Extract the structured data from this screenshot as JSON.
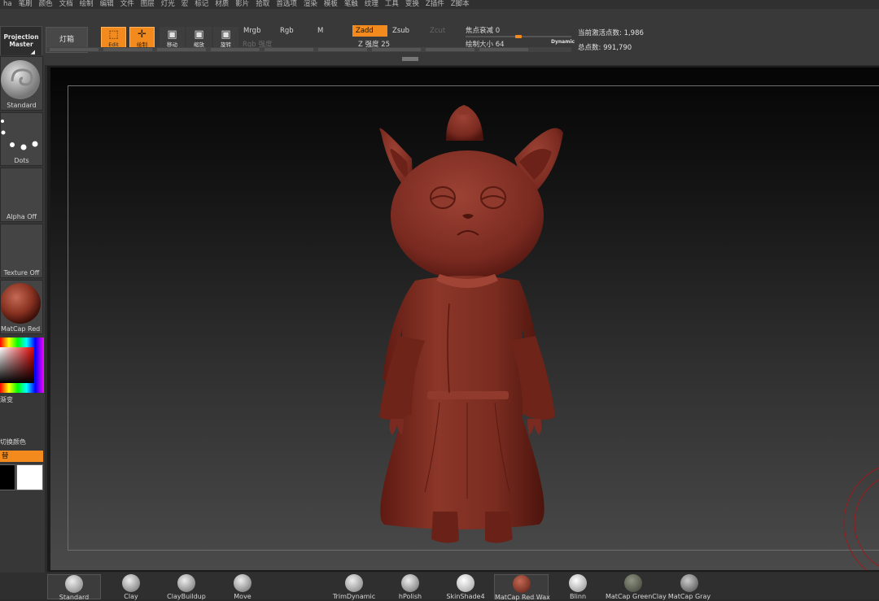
{
  "menu": [
    "ha",
    "笔刷",
    "颜色",
    "文档",
    "绘制",
    "编辑",
    "文件",
    "图层",
    "灯光",
    "宏",
    "标记",
    "材质",
    "影片",
    "拾取",
    "首选项",
    "渲染",
    "模板",
    "笔触",
    "纹理",
    "工具",
    "变换",
    "Z插件",
    "Z脚本"
  ],
  "toolbar": {
    "projection_master": "Projection Master",
    "lightbox": "灯箱",
    "edit_label": "Edit",
    "draw_label": "绘制",
    "move_label": "移动",
    "scale_label": "缩放",
    "rotate_label": "旋转",
    "mrgb": "Mrgb",
    "rgb": "Rgb",
    "m": "M",
    "zadd": "Zadd",
    "zsub": "Zsub",
    "zcut": "Zcut",
    "rgb_intensity": "Rgb 强度",
    "z_intensity": "Z 强度 25",
    "focal_shift": "焦点衰减 0",
    "draw_size": "绘制大小 64",
    "dynamic": "Dynamic",
    "active_points": "当前激活点数: 1,986",
    "total_points": "总点数: 991,790"
  },
  "left_tray": {
    "brush": "Standard",
    "stroke": "Dots",
    "alpha": "Alpha Off",
    "texture": "Texture Off",
    "material": "MatCap Red Wax",
    "gradient_label": "渐变",
    "switch_color": "切换颜色",
    "alternate": "替"
  },
  "colors": {
    "accent": "#f28a1e",
    "model": "#7a2a20",
    "main_color": "#000000",
    "secondary_color": "#ffffff"
  },
  "bottom_shelf": [
    "Standard",
    "Clay",
    "ClayBuildup",
    "Move",
    "TrimDynamic",
    "hPolish",
    "SkinShade4",
    "MatCap Red Wax",
    "Blinn",
    "MatCap GreenClay",
    "MatCap Gray"
  ]
}
